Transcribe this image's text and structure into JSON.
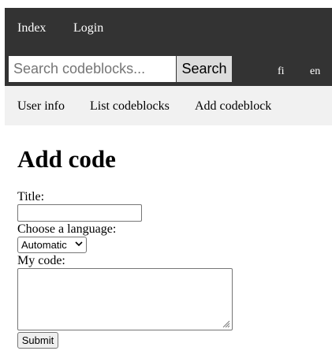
{
  "topnav": {
    "index_label": "Index",
    "login_label": "Login"
  },
  "search": {
    "placeholder": "Search codeblocks...",
    "value": "",
    "button_label": "Search"
  },
  "languages": {
    "fi_label": "fi",
    "en_label": "en"
  },
  "subnav": {
    "user_info_label": "User info",
    "list_codeblocks_label": "List codeblocks",
    "add_codeblock_label": "Add codeblock"
  },
  "form": {
    "page_title": "Add code",
    "title_label": "Title:",
    "title_value": "",
    "language_label": "Choose a language:",
    "language_selected": "Automatic",
    "code_label": "My code:",
    "code_value": "",
    "submit_label": "Submit"
  },
  "colors": {
    "topbar_bg": "#333333",
    "subnav_bg": "#f1f1f1",
    "search_button_bg": "#dddddd"
  },
  "icons": {
    "select_arrow": "chevron-down-icon",
    "textarea_grip": "resize-grip-icon"
  }
}
